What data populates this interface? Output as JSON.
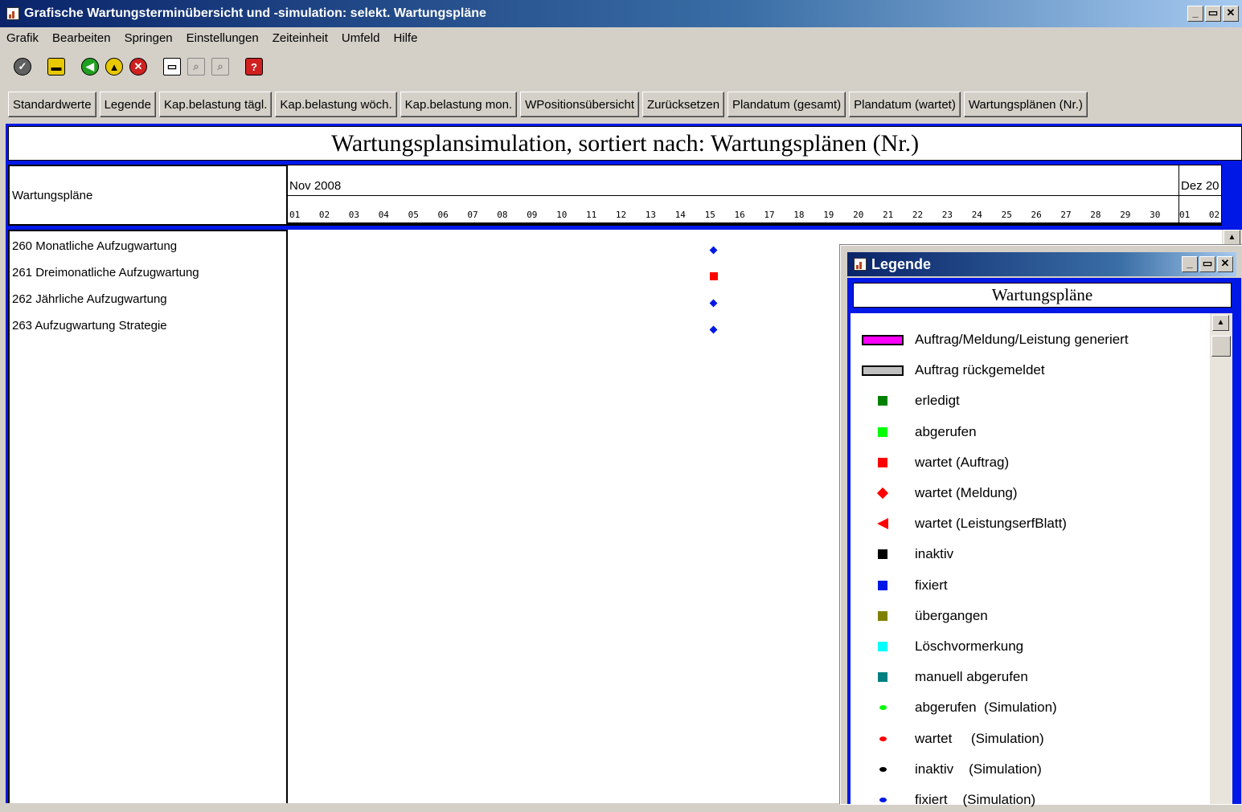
{
  "window": {
    "title": "Grafische Wartungsterminübersicht und -simulation: selekt. Wartungspläne",
    "controls": [
      "_",
      "▭",
      "✕"
    ]
  },
  "menu": [
    "Grafik",
    "Bearbeiten",
    "Springen",
    "Einstellungen",
    "Zeiteinheit",
    "Umfeld",
    "Hilfe"
  ],
  "toolbar_icons": [
    "check-icon",
    "save-icon",
    "back-icon",
    "exit-icon",
    "cancel-icon",
    "print-icon",
    "find-icon",
    "find-next-icon",
    "help-icon"
  ],
  "buttons": [
    "Standardwerte",
    "Legende",
    "Kap.belastung tägl.",
    "Kap.belastung wöch.",
    "Kap.belastung mon.",
    "WPositionsübersicht",
    "Zurücksetzen",
    "Plandatum (gesamt)",
    "Plandatum (wartet)",
    "Wartungsplänen (Nr.)"
  ],
  "chart": {
    "title": "Wartungsplansimulation, sortiert nach: Wartungsplänen (Nr.)",
    "column_header": "Wartungspläne",
    "months": [
      "Nov 2008",
      "Dez 20"
    ],
    "days": [
      "01",
      "02",
      "03",
      "04",
      "05",
      "06",
      "07",
      "08",
      "09",
      "10",
      "11",
      "12",
      "13",
      "14",
      "15",
      "16",
      "17",
      "18",
      "19",
      "20",
      "21",
      "22",
      "23",
      "24",
      "25",
      "26",
      "27",
      "28",
      "29",
      "30",
      "01",
      "02"
    ],
    "rows": [
      {
        "label": "260 Monatliche Aufzugwartung",
        "marker": "fixiert (Simulation)",
        "day": 15,
        "color": "#0018e6",
        "shape": "diamond"
      },
      {
        "label": "261 Dreimonatliche Aufzugwartung",
        "marker": "wartet (Auftrag)",
        "day": 15,
        "color": "#ff0000",
        "shape": "square"
      },
      {
        "label": "262 Jährliche Aufzugwartung",
        "marker": "fixiert (Simulation)",
        "day": 15,
        "color": "#0018e6",
        "shape": "diamond"
      },
      {
        "label": "263 Aufzugwartung Strategie",
        "marker": "fixiert (Simulation)",
        "day": 15,
        "color": "#0018e6",
        "shape": "diamond"
      }
    ]
  },
  "legend": {
    "title": "Legende",
    "header": "Wartungspläne",
    "items": [
      {
        "label": "Auftrag/Meldung/Leistung generiert",
        "shape": "bar",
        "color": "#ff00ff"
      },
      {
        "label": "Auftrag rückgemeldet",
        "shape": "bar",
        "color": "#c0c0c0"
      },
      {
        "label": "erledigt",
        "shape": "square",
        "color": "#008000"
      },
      {
        "label": "abgerufen",
        "shape": "square",
        "color": "#00ff00"
      },
      {
        "label": "wartet (Auftrag)",
        "shape": "square",
        "color": "#ff0000"
      },
      {
        "label": "wartet (Meldung)",
        "shape": "diamond",
        "color": "#ff0000"
      },
      {
        "label": "wartet (LeistungserfBlatt)",
        "shape": "triangle",
        "color": "#ff0000"
      },
      {
        "label": "inaktiv",
        "shape": "square",
        "color": "#000000"
      },
      {
        "label": "fixiert",
        "shape": "square",
        "color": "#0018e6"
      },
      {
        "label": "übergangen",
        "shape": "square",
        "color": "#808000"
      },
      {
        "label": "Löschvormerkung",
        "shape": "square",
        "color": "#00ffff"
      },
      {
        "label": "manuell abgerufen",
        "shape": "square",
        "color": "#008080"
      },
      {
        "label": "abgerufen  (Simulation)",
        "shape": "dot",
        "color": "#00ff00"
      },
      {
        "label": "wartet     (Simulation)",
        "shape": "dot",
        "color": "#ff0000"
      },
      {
        "label": "inaktiv    (Simulation)",
        "shape": "dot",
        "color": "#000000"
      },
      {
        "label": "fixiert    (Simulation)",
        "shape": "dot",
        "color": "#0018e6"
      }
    ]
  }
}
